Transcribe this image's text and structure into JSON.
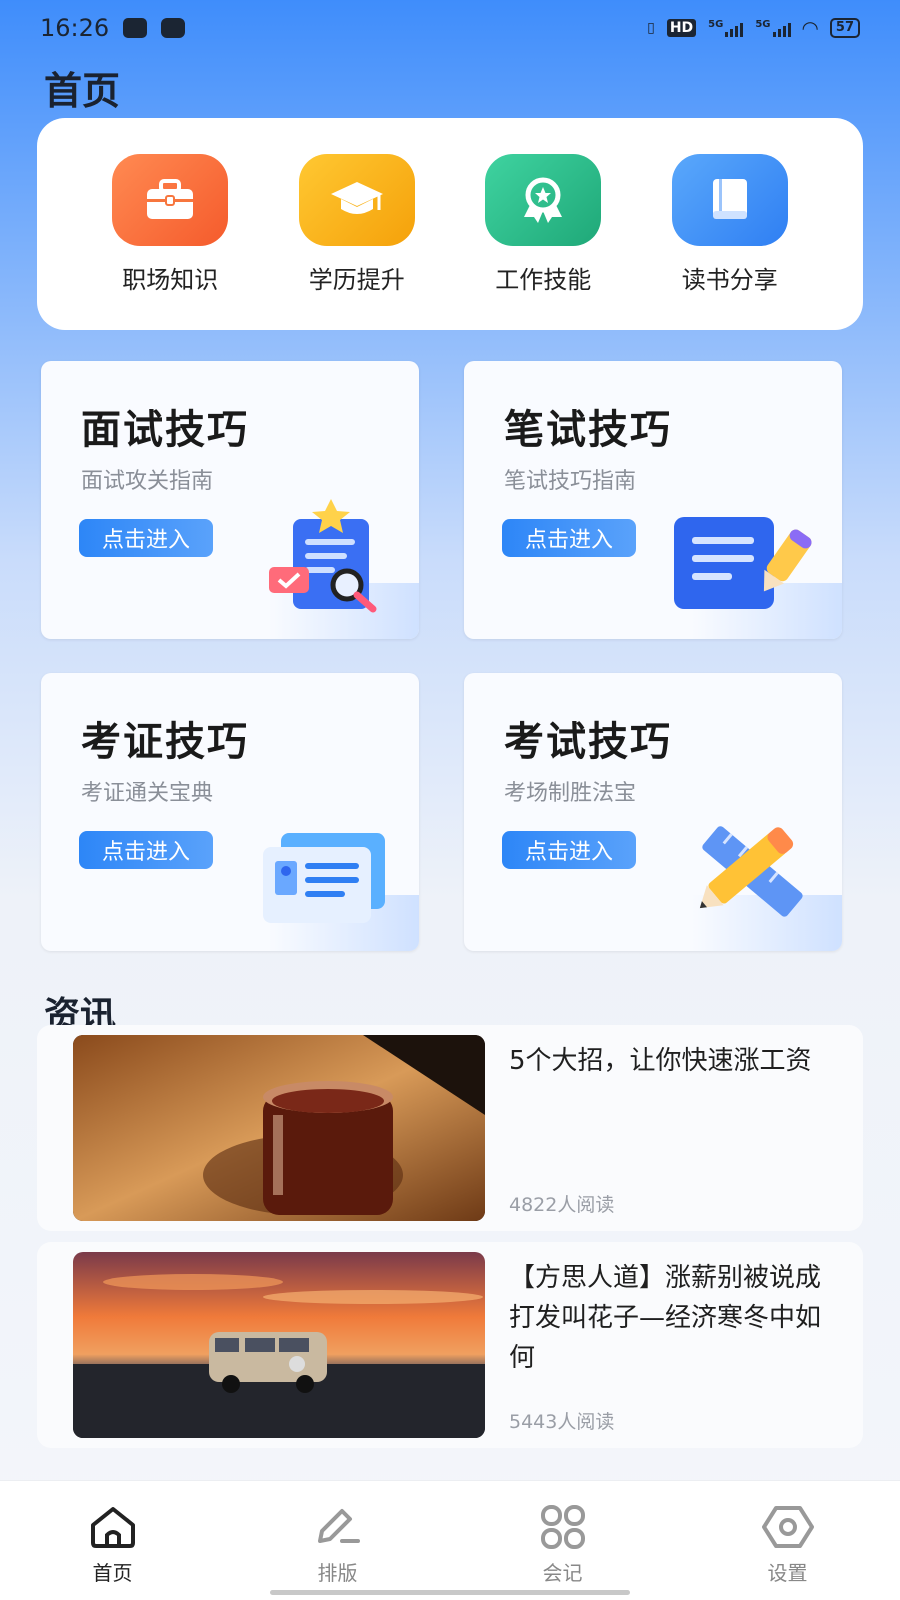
{
  "status_bar": {
    "time": "16:26",
    "battery": "57",
    "network": "5G"
  },
  "page_title": "首页",
  "quick_links": [
    {
      "label": "职场知识",
      "icon": "briefcase-icon",
      "color": "#f96a3c"
    },
    {
      "label": "学历提升",
      "icon": "graduation-cap-icon",
      "color": "#f9b316"
    },
    {
      "label": "工作技能",
      "icon": "award-badge-icon",
      "color": "#2cb98a"
    },
    {
      "label": "读书分享",
      "icon": "book-icon",
      "color": "#3a8ef7"
    }
  ],
  "tiles": [
    {
      "title": "面试技巧",
      "subtitle": "面试攻关指南",
      "button": "点击进入",
      "icon": "interview-clipboard-icon"
    },
    {
      "title": "笔试技巧",
      "subtitle": "笔试技巧指南",
      "button": "点击进入",
      "icon": "written-test-doc-icon"
    },
    {
      "title": "考证技巧",
      "subtitle": "考证通关宝典",
      "button": "点击进入",
      "icon": "certificate-card-icon"
    },
    {
      "title": "考试技巧",
      "subtitle": "考场制胜法宝",
      "button": "点击进入",
      "icon": "pencil-ruler-icon"
    }
  ],
  "news_section_title": "资讯",
  "news": [
    {
      "title": "5个大招，让你快速涨工资",
      "reads": "4822人阅读",
      "image": "iced-drink-photo"
    },
    {
      "title": "【方思人道】涨薪别被说成打发叫花子—经济寒冬中如何",
      "reads": "5443人阅读",
      "image": "van-sunset-photo"
    }
  ],
  "bottom_nav": [
    {
      "label": "首页",
      "icon": "home-icon",
      "active": true
    },
    {
      "label": "排版",
      "icon": "pen-edit-icon",
      "active": false
    },
    {
      "label": "会记",
      "icon": "grid-four-icon",
      "active": false
    },
    {
      "label": "设置",
      "icon": "hexagon-settings-icon",
      "active": false
    }
  ]
}
